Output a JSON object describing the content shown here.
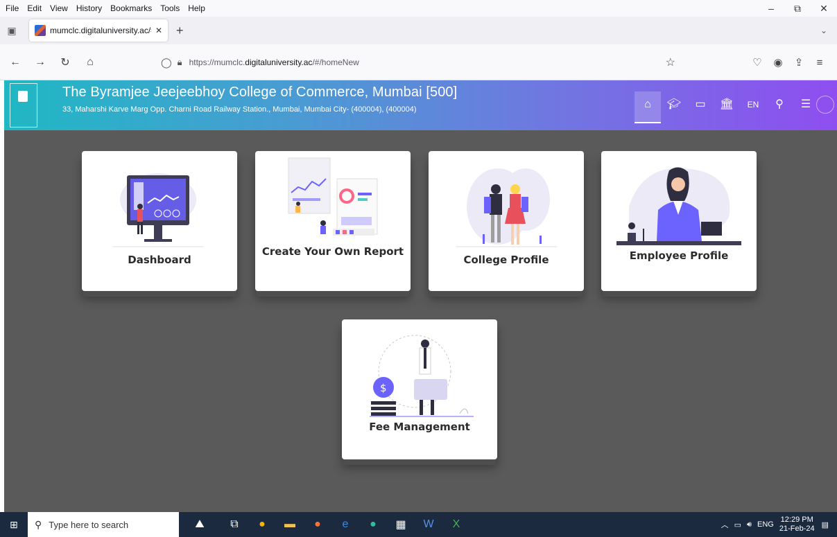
{
  "menubar": {
    "items": [
      "File",
      "Edit",
      "View",
      "History",
      "Bookmarks",
      "Tools",
      "Help"
    ]
  },
  "window_controls": {
    "minimize": "–",
    "restore": "⧉",
    "close": "✕"
  },
  "tab": {
    "title": "mumclc.digitaluniversity.ac/#/",
    "close": "✕",
    "new_tab": "+"
  },
  "nav": {
    "url_prefix": "https://mumclc.",
    "url_domain": "digitaluniversity.ac",
    "url_suffix": "/#/homeNew"
  },
  "header": {
    "institution": "The Byramjee Jeejeebhoy College of Commerce, Mumbai [500]",
    "address": "33, Maharshi Karve Marg Opp. Charni Road Railway Station., Mumbai, Mumbai City- (400004), (400004)",
    "lang": "EN"
  },
  "tiles": [
    {
      "label": "Dashboard"
    },
    {
      "label": "Create Your Own Report"
    },
    {
      "label": "College Profile"
    },
    {
      "label": "Employee Profile"
    },
    {
      "label": "Fee Management"
    }
  ],
  "taskbar": {
    "search_placeholder": "Type here to search",
    "lang": "ENG",
    "time": "12:29 PM",
    "date": "21-Feb-24"
  },
  "colors": {
    "header_gradient_start": "#1fb8c4",
    "header_gradient_end": "#8f4ef0",
    "viewport_bg": "#5a5a5a",
    "illustration_accent": "#6c63ff"
  }
}
